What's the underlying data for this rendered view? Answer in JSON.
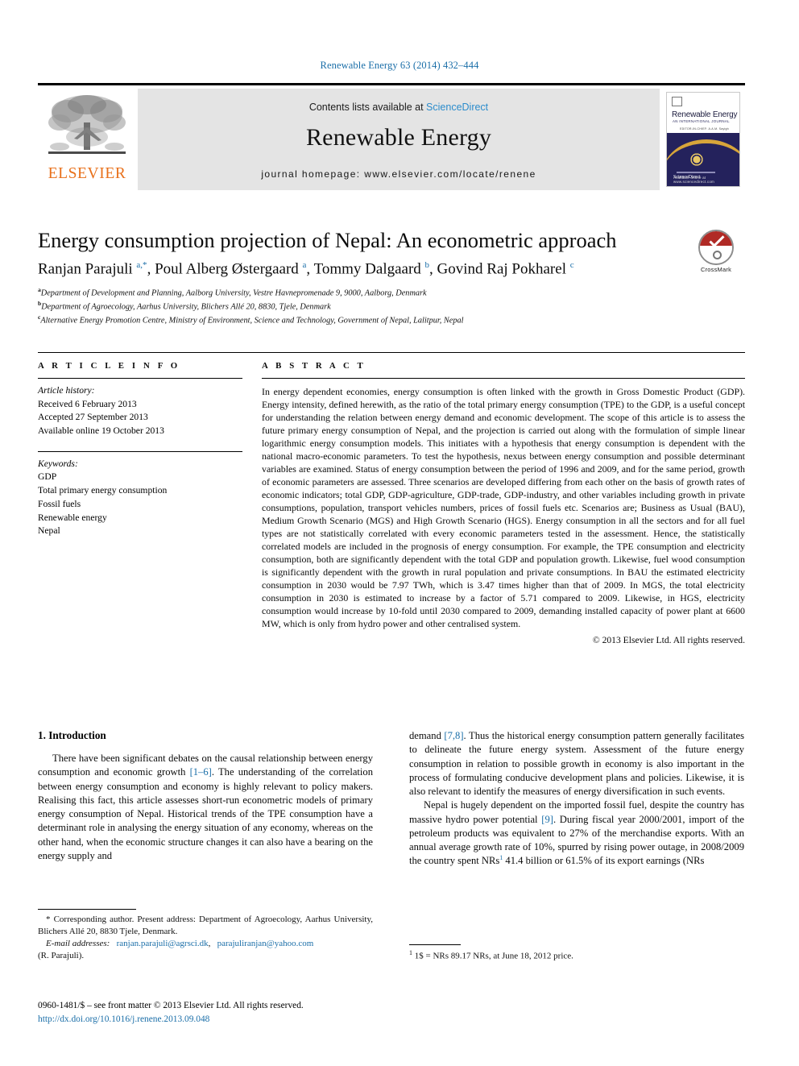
{
  "running_head": "Renewable Energy 63 (2014) 432–444",
  "masthead": {
    "publisher_logo_text": "ELSEVIER",
    "contents_prefix": "Contents lists available at ",
    "contents_link": "ScienceDirect",
    "journal_name": "Renewable Energy",
    "homepage_line": "journal homepage: www.elsevier.com/locate/renene",
    "cover": {
      "title": "Renewable Energy",
      "subtitle": "AN INTERNATIONAL JOURNAL",
      "subtitle2": "EDITOR-IN-CHIEF: A.A.M. Sayigh",
      "footer_brand": "ScienceDirect",
      "footer_publisher": "Available online at www.sciencedirect.com"
    }
  },
  "article": {
    "title": "Energy consumption projection of Nepal: An econometric approach",
    "authors_html": "Ranjan Parajuli <sup>a,*</sup>, Poul Alberg Østergaard <sup>a</sup>, Tommy Dalgaard <sup>b</sup>, Govind Raj Pokharel <sup>c</sup>",
    "affiliations": [
      "a Department of Development and Planning, Aalborg University, Vestre Havnepromenade 9, 9000, Aalborg, Denmark",
      "b Department of Agroecology, Aarhus University, Blichers Allé 20, 8830, Tjele, Denmark",
      "c Alternative Energy Promotion Centre, Ministry of Environment, Science and Technology, Government of Nepal, Lalitpur, Nepal"
    ],
    "crossmark_label": "CrossMark"
  },
  "article_info": {
    "heading": "A R T I C L E   I N F O",
    "history_label": "Article history:",
    "history": [
      "Received 6 February 2013",
      "Accepted 27 September 2013",
      "Available online 19 October 2013"
    ],
    "keywords_label": "Keywords:",
    "keywords": [
      "GDP",
      "Total primary energy consumption",
      "Fossil fuels",
      "Renewable energy",
      "Nepal"
    ]
  },
  "abstract": {
    "heading": "A B S T R A C T",
    "text": "In energy dependent economies, energy consumption is often linked with the growth in Gross Domestic Product (GDP). Energy intensity, defined herewith, as the ratio of the total primary energy consumption (TPE) to the GDP, is a useful concept for understanding the relation between energy demand and economic development. The scope of this article is to assess the future primary energy consumption of Nepal, and the projection is carried out along with the formulation of simple linear logarithmic energy consumption models. This initiates with a hypothesis that energy consumption is dependent with the national macro-economic parameters. To test the hypothesis, nexus between energy consumption and possible determinant variables are examined. Status of energy consumption between the period of 1996 and 2009, and for the same period, growth of economic parameters are assessed. Three scenarios are developed differing from each other on the basis of growth rates of economic indicators; total GDP, GDP-agriculture, GDP-trade, GDP-industry, and other variables including growth in private consumptions, population, transport vehicles numbers, prices of fossil fuels etc. Scenarios are; Business as Usual (BAU), Medium Growth Scenario (MGS) and High Growth Scenario (HGS). Energy consumption in all the sectors and for all fuel types are not statistically correlated with every economic parameters tested in the assessment. Hence, the statistically correlated models are included in the prognosis of energy consumption. For example, the TPE consumption and electricity consumption, both are significantly dependent with the total GDP and population growth. Likewise, fuel wood consumption is significantly dependent with the growth in rural population and private consumptions. In BAU the estimated electricity consumption in 2030 would be 7.97 TWh, which is 3.47 times higher than that of 2009. In MGS, the total electricity consumption in 2030 is estimated to increase by a factor of 5.71 compared to 2009. Likewise, in HGS, electricity consumption would increase by 10-fold until 2030 compared to 2009, demanding installed capacity of power plant at 6600 MW, which is only from hydro power and other centralised system.",
    "copyright": "© 2013 Elsevier Ltd. All rights reserved."
  },
  "introduction": {
    "section_number_title": "1. Introduction",
    "left_para_1_a": "There have been significant debates on the causal relationship between energy consumption and economic growth ",
    "left_para_1_ref": "[1–6]",
    "left_para_1_b": ". The understanding of the correlation between energy consumption and economy is highly relevant to policy makers. Realising this fact, this article assesses short-run econometric models of primary energy consumption of Nepal. Historical trends of the TPE consumption have a determinant role in analysing the energy situation of any economy, whereas on the other hand, when the economic structure changes it can also have a bearing on the energy supply and",
    "right_para_1_a": "demand ",
    "right_para_1_ref": "[7,8]",
    "right_para_1_b": ". Thus the historical energy consumption pattern generally facilitates to delineate the future energy system. Assessment of the future energy consumption in relation to possible growth in economy is also important in the process of formulating conducive development plans and policies. Likewise, it is also relevant to identify the measures of energy diversification in such events.",
    "right_para_2_a": "Nepal is hugely dependent on the imported fossil fuel, despite the country has massive hydro power potential ",
    "right_para_2_ref": "[9]",
    "right_para_2_b": ". During fiscal year 2000/2001, import of the petroleum products was equivalent to 27% of the merchandise exports. With an annual average growth rate of 10%, spurred by rising power outage, in 2008/2009 the country spent NRs",
    "right_para_2_fn": "1",
    "right_para_2_c": " 41.4 billion or 61.5% of its export earnings (NRs"
  },
  "footnotes": {
    "corresponding": "* Corresponding author. Present address: Department of Agroecology, Aarhus University, Blichers Allé 20, 8830 Tjele, Denmark.",
    "email_label": "E-mail addresses:",
    "email_1": "ranjan.parajuli@agrsci.dk",
    "email_2": "parajuliranjan@yahoo.com",
    "email_tail": "(R. Parajuli).",
    "footnote_marker": "1",
    "footnote_1": "1$ = NRs 89.17 NRs, at June 18, 2012 price."
  },
  "issn": {
    "line1": "0960-1481/$ – see front matter © 2013 Elsevier Ltd. All rights reserved.",
    "doi": "http://dx.doi.org/10.1016/j.renene.2013.09.048"
  },
  "colors": {
    "link_blue": "#1a6ea8",
    "sciencedirect_blue": "#2b8ccc",
    "elsevier_orange": "#E8701A",
    "masthead_grey": "#e4e4e4",
    "crossmark_red": "#b02a25"
  }
}
